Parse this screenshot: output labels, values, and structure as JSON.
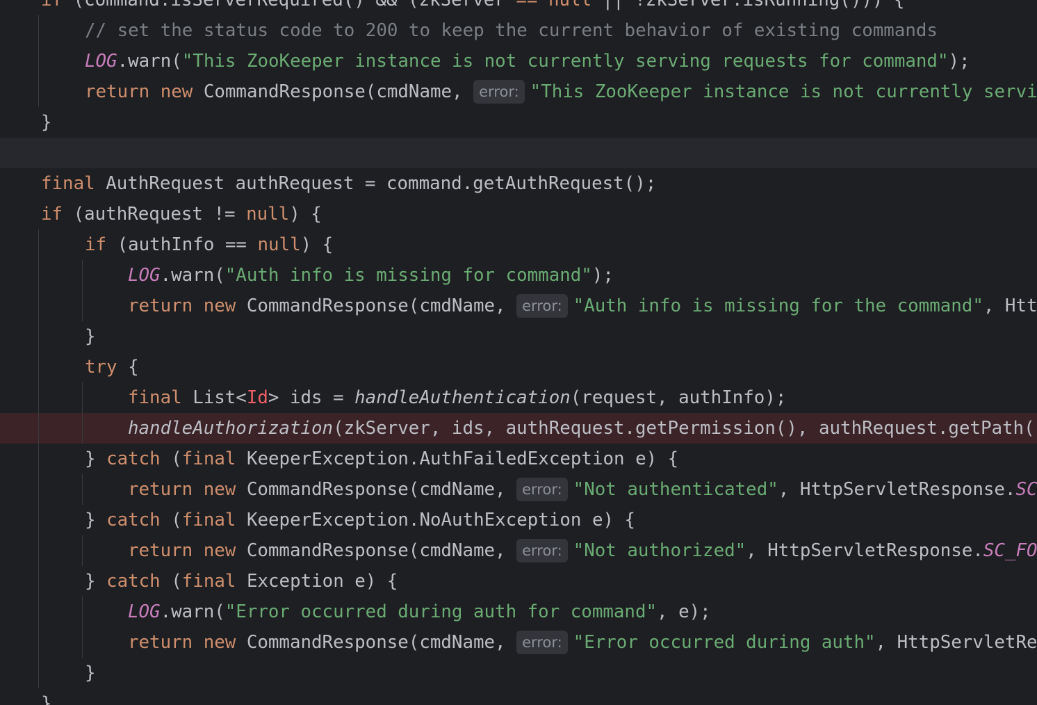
{
  "editor": {
    "lines": [
      {
        "indent": 1,
        "tokens": [
          [
            "kw",
            "if "
          ],
          [
            "plain",
            "(command.isServerRequired() && (zkServer "
          ],
          [
            "kw",
            "== null "
          ],
          [
            "plain",
            "|| !zkServer.isRunning())) {"
          ]
        ]
      },
      {
        "indent": 2,
        "tokens": [
          [
            "cmt",
            "// set the status code to 200 to keep the current behavior of existing commands"
          ]
        ]
      },
      {
        "indent": 2,
        "tokens": [
          [
            "static",
            "LOG"
          ],
          [
            "plain",
            ".warn("
          ],
          [
            "str",
            "\"This ZooKeeper instance is not currently serving requests for command\""
          ],
          [
            "plain",
            ");"
          ]
        ]
      },
      {
        "indent": 2,
        "tokens": [
          [
            "kw",
            "return new "
          ],
          [
            "plain",
            "CommandResponse(cmdName, "
          ],
          [
            "hint",
            "error:"
          ],
          [
            "str",
            "\"This ZooKeeper instance is not currently serving requests\""
          ]
        ]
      },
      {
        "indent": 1,
        "tokens": [
          [
            "plain",
            "}"
          ]
        ]
      },
      {
        "indent": 0,
        "cursor": true,
        "tokens": []
      },
      {
        "indent": 1,
        "tokens": [
          [
            "kw",
            "final "
          ],
          [
            "plain",
            "AuthRequest authRequest = command.getAuthRequest();"
          ]
        ]
      },
      {
        "indent": 1,
        "tokens": [
          [
            "kw",
            "if "
          ],
          [
            "plain",
            "(authRequest != "
          ],
          [
            "kw",
            "null"
          ],
          [
            "plain",
            ") {"
          ]
        ]
      },
      {
        "indent": 2,
        "tokens": [
          [
            "kw",
            "if "
          ],
          [
            "plain",
            "(authInfo == "
          ],
          [
            "kw",
            "null"
          ],
          [
            "plain",
            ") {"
          ]
        ]
      },
      {
        "indent": 3,
        "tokens": [
          [
            "static",
            "LOG"
          ],
          [
            "plain",
            ".warn("
          ],
          [
            "str",
            "\"Auth info is missing for command\""
          ],
          [
            "plain",
            ");"
          ]
        ]
      },
      {
        "indent": 3,
        "tokens": [
          [
            "kw",
            "return new "
          ],
          [
            "plain",
            "CommandResponse(cmdName, "
          ],
          [
            "hint",
            "error:"
          ],
          [
            "str",
            "\"Auth info is missing for the command\""
          ],
          [
            "plain",
            ", HttpServletResponse"
          ]
        ]
      },
      {
        "indent": 2,
        "tokens": [
          [
            "plain",
            "}"
          ]
        ]
      },
      {
        "indent": 2,
        "tokens": [
          [
            "kw",
            "try "
          ],
          [
            "plain",
            "{"
          ]
        ]
      },
      {
        "indent": 3,
        "tokens": [
          [
            "kw",
            "final "
          ],
          [
            "plain",
            "List<"
          ],
          [
            "type",
            "Id"
          ],
          [
            "plain",
            "> ids = "
          ],
          [
            "fn",
            "handleAuthentication"
          ],
          [
            "plain",
            "(request, authInfo);"
          ]
        ]
      },
      {
        "indent": 3,
        "breakpoint": true,
        "tokens": [
          [
            "fn",
            "handleAuthorization"
          ],
          [
            "plain",
            "(zkServer, ids, authRequest.getPermission(), authRequest.getPath());"
          ]
        ]
      },
      {
        "indent": 2,
        "tokens": [
          [
            "plain",
            "} "
          ],
          [
            "kw",
            "catch "
          ],
          [
            "plain",
            "("
          ],
          [
            "kw",
            "final "
          ],
          [
            "plain",
            "KeeperException.AuthFailedException e) {"
          ]
        ]
      },
      {
        "indent": 3,
        "tokens": [
          [
            "kw",
            "return new "
          ],
          [
            "plain",
            "CommandResponse(cmdName, "
          ],
          [
            "hint",
            "error:"
          ],
          [
            "str",
            "\"Not authenticated\""
          ],
          [
            "plain",
            ", HttpServletResponse."
          ],
          [
            "static",
            "SC_UNAUTHORIZED"
          ]
        ]
      },
      {
        "indent": 2,
        "tokens": [
          [
            "plain",
            "} "
          ],
          [
            "kw",
            "catch "
          ],
          [
            "plain",
            "("
          ],
          [
            "kw",
            "final "
          ],
          [
            "plain",
            "KeeperException.NoAuthException e) {"
          ]
        ]
      },
      {
        "indent": 3,
        "tokens": [
          [
            "kw",
            "return new "
          ],
          [
            "plain",
            "CommandResponse(cmdName, "
          ],
          [
            "hint",
            "error:"
          ],
          [
            "str",
            "\"Not authorized\""
          ],
          [
            "plain",
            ", HttpServletResponse."
          ],
          [
            "static",
            "SC_FORBIDDEN"
          ]
        ]
      },
      {
        "indent": 2,
        "tokens": [
          [
            "plain",
            "} "
          ],
          [
            "kw",
            "catch "
          ],
          [
            "plain",
            "("
          ],
          [
            "kw",
            "final "
          ],
          [
            "plain",
            "Exception e) {"
          ]
        ]
      },
      {
        "indent": 3,
        "tokens": [
          [
            "static",
            "LOG"
          ],
          [
            "plain",
            ".warn("
          ],
          [
            "str",
            "\"Error occurred during auth for command\""
          ],
          [
            "plain",
            ", e);"
          ]
        ]
      },
      {
        "indent": 3,
        "tokens": [
          [
            "kw",
            "return new "
          ],
          [
            "plain",
            "CommandResponse(cmdName, "
          ],
          [
            "hint",
            "error:"
          ],
          [
            "str",
            "\"Error occurred during auth\""
          ],
          [
            "plain",
            ", HttpServletResponse"
          ]
        ]
      },
      {
        "indent": 2,
        "tokens": [
          [
            "plain",
            "}"
          ]
        ]
      },
      {
        "indent": 1,
        "tokens": [
          [
            "plain",
            "}"
          ]
        ]
      }
    ]
  }
}
